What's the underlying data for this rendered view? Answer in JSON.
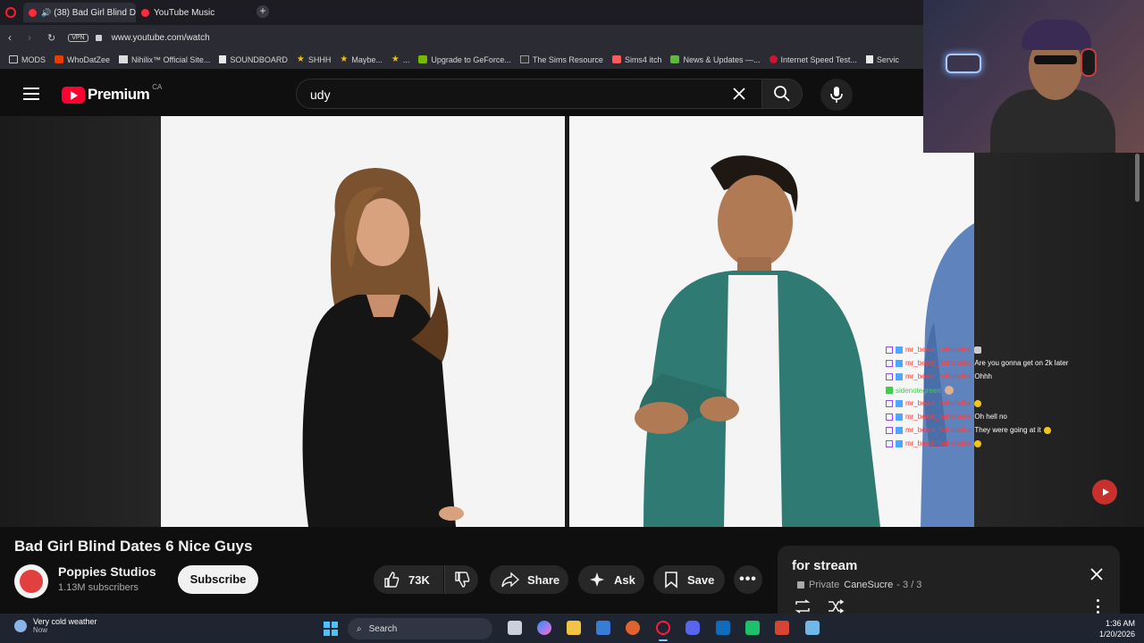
{
  "browser": {
    "tabs": [
      {
        "label": "(38) Bad Girl Blind Da",
        "active": true
      },
      {
        "label": "YouTube Music",
        "active": false
      }
    ],
    "url": "www.youtube.com/watch",
    "vpn_label": "VPN",
    "bookmarks": [
      {
        "label": "MODS",
        "icon": "folder-icon"
      },
      {
        "label": "WhoDatZee",
        "icon": "youtube-icon"
      },
      {
        "label": "Nihilix™ Official Site...",
        "icon": "site-icon"
      },
      {
        "label": "SOUNDBOARD",
        "icon": "page-icon"
      },
      {
        "label": "SHHH",
        "icon": "star-icon"
      },
      {
        "label": "Maybe...",
        "icon": "star-icon"
      },
      {
        "label": "...",
        "icon": "star-icon"
      },
      {
        "label": "Upgrade to GeForce...",
        "icon": "nvidia-icon"
      },
      {
        "label": "The Sims Resource",
        "icon": "tsr-icon"
      },
      {
        "label": "Sims4 itch",
        "icon": "itch-icon"
      },
      {
        "label": "News & Updates —...",
        "icon": "news-icon"
      },
      {
        "label": "Internet Speed Test...",
        "icon": "speedtest-icon"
      },
      {
        "label": "Servic",
        "icon": "page-icon"
      }
    ]
  },
  "youtube": {
    "logo_text": "Premium",
    "region": "CA",
    "search_value": "udy"
  },
  "chat": [
    {
      "user": "mr_beast_hahahaha",
      "msg": "",
      "emote": "emote-icon"
    },
    {
      "user": "mr_beast_hahahaha",
      "msg": "Are you gonna get on 2k later"
    },
    {
      "user": "mr_beast_hahahaha",
      "msg": "Ohhh"
    },
    {
      "user": "sidenotegreen",
      "msg": "",
      "emote": "emote-icon",
      "color": "#3ecf4a"
    },
    {
      "user": "mr_beast_hahahaha",
      "msg": "",
      "emote": "emoji-icon"
    },
    {
      "user": "mr_beast_hahahaha",
      "msg": "Oh hell no"
    },
    {
      "user": "mr_beast_hahahaha",
      "msg": "They were going at it",
      "emote": "emoji-icon"
    },
    {
      "user": "mr_beast_hahahaha",
      "msg": "",
      "emote": "emoji-icon"
    }
  ],
  "video": {
    "title": "Bad Girl Blind Dates 6 Nice Guys",
    "channel": "Poppies Studios",
    "subscribers": "1.13M subscribers",
    "subscribe_label": "Subscribe",
    "likes": "73K",
    "share_label": "Share",
    "ask_label": "Ask",
    "save_label": "Save"
  },
  "playlist": {
    "title": "for stream",
    "privacy": "Private",
    "owner": "CaneSucre",
    "position": "- 3 / 3"
  },
  "taskbar": {
    "weather_title": "Very cold weather",
    "weather_sub": "Now",
    "search_label": "Search",
    "time": "1:36 AM",
    "date": "1/20/2026"
  },
  "colors": {
    "youtube_red": "#ff0033",
    "chat_user": "#ff3b3b",
    "accent_blue": "#3ea6ff"
  }
}
